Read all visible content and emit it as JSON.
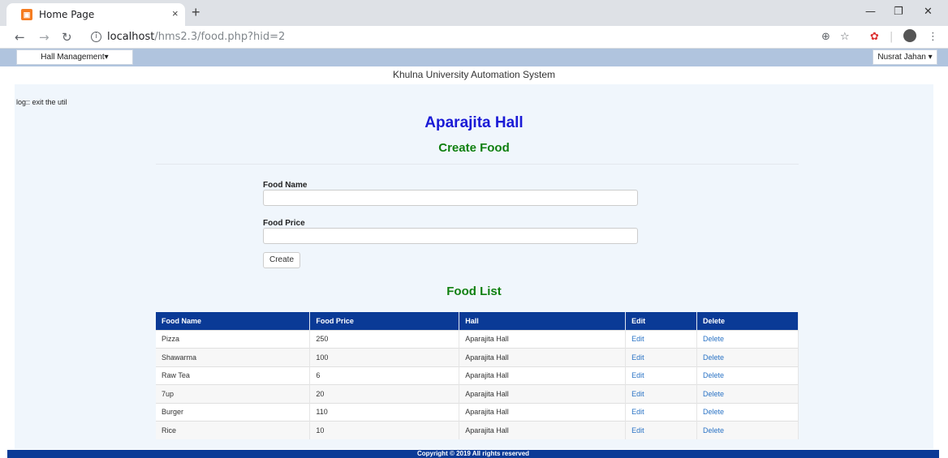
{
  "browser": {
    "tab_title": "Home Page",
    "tab_close": "×",
    "new_tab": "+",
    "url_host": "localhost",
    "url_path": "/hms2.3/food.php?hid=2",
    "icons": [
      "favicon-icon",
      "back-icon",
      "forward-icon",
      "reload-icon",
      "info-icon",
      "zoom-icon",
      "star-icon",
      "extension-icon",
      "profile-icon",
      "menu-icon",
      "minimize-icon",
      "restore-icon",
      "close-window-icon"
    ]
  },
  "navbar": {
    "hall_menu": "Hall Management",
    "user_menu": "Nusrat Jahan"
  },
  "system_title": "Khulna University Automation System",
  "log_text": "log:: exit the util",
  "hall_title": "Aparajita Hall",
  "create_heading": "Create Food",
  "form": {
    "food_name_label": "Food Name",
    "food_name_value": "",
    "food_price_label": "Food Price",
    "food_price_value": "",
    "create_label": "Create"
  },
  "list_heading": "Food List",
  "table": {
    "headers": [
      "Food Name",
      "Food Price",
      "Hall",
      "Edit",
      "Delete"
    ],
    "rows": [
      {
        "name": "Pizza",
        "price": "250",
        "hall": "Aparajita Hall",
        "edit": "Edit",
        "delete": "Delete"
      },
      {
        "name": "Shawarma",
        "price": "100",
        "hall": "Aparajita Hall",
        "edit": "Edit",
        "delete": "Delete"
      },
      {
        "name": "Raw Tea",
        "price": "6",
        "hall": "Aparajita Hall",
        "edit": "Edit",
        "delete": "Delete"
      },
      {
        "name": "7up",
        "price": "20",
        "hall": "Aparajita Hall",
        "edit": "Edit",
        "delete": "Delete"
      },
      {
        "name": "Burger",
        "price": "110",
        "hall": "Aparajita Hall",
        "edit": "Edit",
        "delete": "Delete"
      },
      {
        "name": "Rice",
        "price": "10",
        "hall": "Aparajita Hall",
        "edit": "Edit",
        "delete": "Delete"
      }
    ]
  },
  "footer": "Copyright © 2019 All rights reserved",
  "colors": {
    "navbar_bg": "#b0c4de",
    "content_bg": "#f0f6fc",
    "table_header_bg": "#0a3a96",
    "hall_title": "#1a1ad6",
    "heading_green": "#108010",
    "link_blue": "#2a73c5"
  }
}
